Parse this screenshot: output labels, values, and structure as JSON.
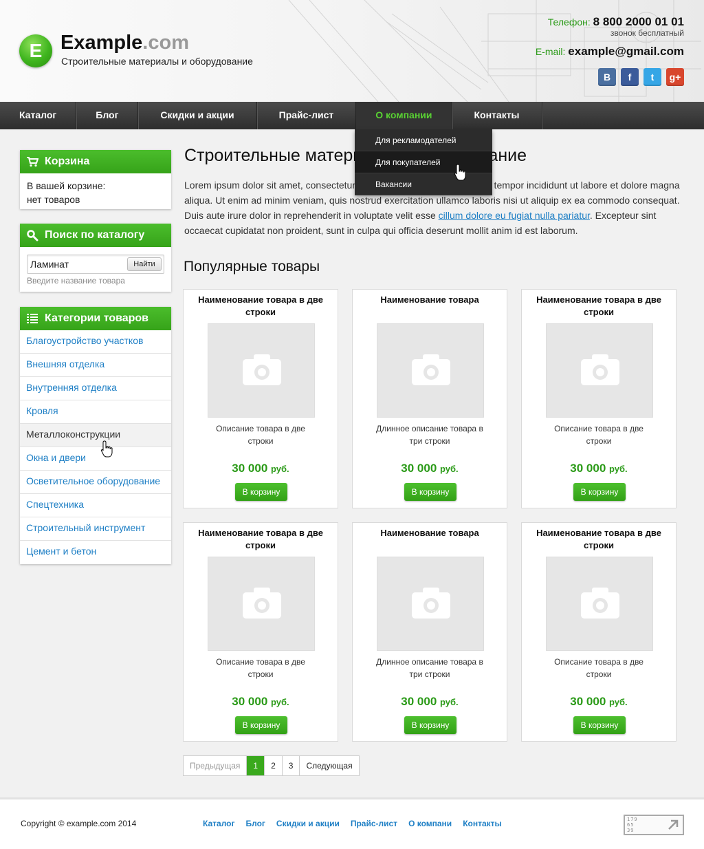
{
  "header": {
    "logo_letter": "E",
    "site_name": "Example",
    "site_tld": ".com",
    "tagline": "Строительные материалы и оборудование",
    "phone_label": "Телефон:",
    "phone_number": "8 800 2000 01 01",
    "phone_note": "звонок бесплатный",
    "email_label": "E-mail:",
    "email_value": "example@gmail.com",
    "socials": [
      {
        "name": "vk-icon",
        "glyph": "B",
        "color": "#4a6fa0"
      },
      {
        "name": "facebook-icon",
        "glyph": "f",
        "color": "#3b5b9a"
      },
      {
        "name": "twitter-icon",
        "glyph": "t",
        "color": "#35a6e6"
      },
      {
        "name": "google-plus-icon",
        "glyph": "g+",
        "color": "#d8472e"
      }
    ]
  },
  "nav": {
    "items": [
      {
        "label": "Каталог"
      },
      {
        "label": "Блог"
      },
      {
        "label": "Скидки и акции"
      },
      {
        "label": "Прайс-лист"
      },
      {
        "label": "О компании",
        "active": true
      },
      {
        "label": "Контакты"
      }
    ],
    "dropdown": [
      {
        "label": "Для рекламодателей"
      },
      {
        "label": "Для покупателей",
        "hover": true
      },
      {
        "label": "Вакансии"
      }
    ]
  },
  "sidebar": {
    "cart": {
      "title": "Корзина",
      "line1": "В вашей корзине:",
      "line2": "нет товаров"
    },
    "search": {
      "title": "Поиск по каталогу",
      "value": "Ламинат",
      "button": "Найти",
      "hint": "Введите название товара"
    },
    "categories": {
      "title": "Категории товаров",
      "items": [
        {
          "label": "Благоустройство участков"
        },
        {
          "label": "Внешняя отделка"
        },
        {
          "label": "Внутренняя отделка"
        },
        {
          "label": "Кровля"
        },
        {
          "label": "Металлоконструкции",
          "hover": true
        },
        {
          "label": "Окна и двери"
        },
        {
          "label": "Осветительное оборудование"
        },
        {
          "label": "Спецтехника"
        },
        {
          "label": "Строительный инструмент"
        },
        {
          "label": "Цемент и бетон"
        }
      ]
    }
  },
  "main": {
    "title": "Строительные материалы и оборудование",
    "intro_before_link": "Lorem ipsum dolor sit amet, consectetur adipisicing elit, sed do eiusmod tempor incididunt ut labore et dolore magna aliqua. Ut enim ad minim veniam, quis nostrud exercitation ullamco laboris nisi ut aliquip ex ea commodo consequat. Duis aute irure dolor in reprehenderit in voluptate velit esse ",
    "intro_link": "cillum dolore eu fugiat nulla pariatur",
    "intro_after_link": ". Excepteur sint occaecat cupidatat non proident, sunt in culpa qui officia deserunt mollit anim id est laborum.",
    "popular_title": "Популярные товары",
    "products": [
      {
        "name": "Наименование товара в две строки",
        "desc": "Описание товара в две строки",
        "price": "30 000",
        "currency": "руб.",
        "button": "В корзину"
      },
      {
        "name": "Наименование товара",
        "desc": "Длинное описание товара в три строки",
        "price": "30 000",
        "currency": "руб.",
        "button": "В корзину"
      },
      {
        "name": "Наименование товара в две строки",
        "desc": "Описание товара в две строки",
        "price": "30 000",
        "currency": "руб.",
        "button": "В корзину"
      },
      {
        "name": "Наименование товара в две строки",
        "desc": "Описание товара в две строки",
        "price": "30 000",
        "currency": "руб.",
        "button": "В корзину"
      },
      {
        "name": "Наименование товара",
        "desc": "Длинное описание товара в три строки",
        "price": "30 000",
        "currency": "руб.",
        "button": "В корзину"
      },
      {
        "name": "Наименование товара в две строки",
        "desc": "Описание товара в две строки",
        "price": "30 000",
        "currency": "руб.",
        "button": "В корзину"
      }
    ],
    "pagination": {
      "prev": "Предыдущая",
      "pages": [
        "1",
        "2",
        "3"
      ],
      "current": "1",
      "next": "Следующая"
    }
  },
  "footer": {
    "copyright": "Copyright © example.com 2014",
    "links": [
      "Каталог",
      "Блог",
      "Скидки и акции",
      "Прайс-лист",
      "О компани",
      "Контакты"
    ],
    "counter": [
      "179",
      "65",
      "39"
    ]
  },
  "colors": {
    "accent_green": "#3aa91d",
    "link_blue": "#1e7fc5",
    "nav_dark": "#333333"
  }
}
